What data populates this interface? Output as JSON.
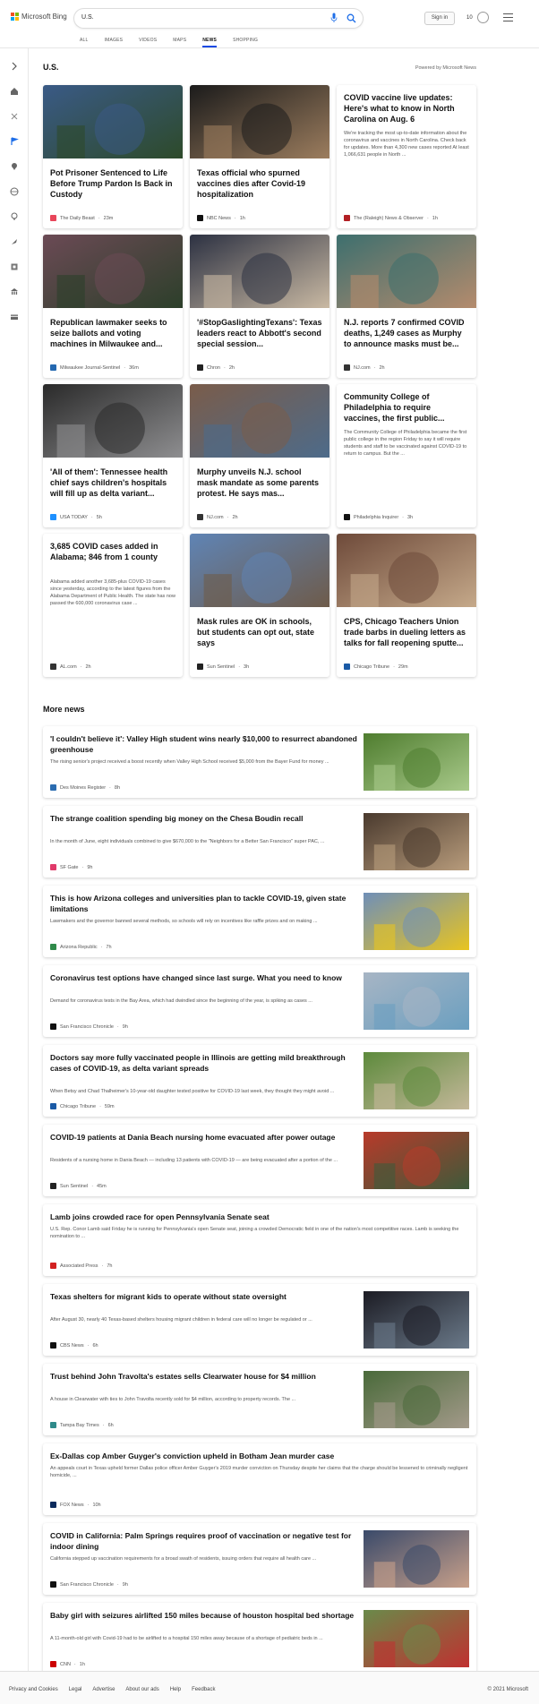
{
  "header": {
    "brand": "Microsoft Bing",
    "search_value": "U.S.",
    "signin_label": "Sign in",
    "rewards_count": "10",
    "tabs": [
      {
        "label": "ALL",
        "active": false
      },
      {
        "label": "IMAGES",
        "active": false
      },
      {
        "label": "VIDEOS",
        "active": false
      },
      {
        "label": "MAPS",
        "active": false
      },
      {
        "label": "NEWS",
        "active": true
      },
      {
        "label": "SHOPPING",
        "active": false
      }
    ]
  },
  "sidebar": {
    "icons": [
      "chevron-right-icon",
      "home-icon",
      "discover-icon",
      "flag-icon",
      "location-icon",
      "globe-icon",
      "lightbulb-icon",
      "rocket-icon",
      "film-icon",
      "bank-icon",
      "card-icon"
    ]
  },
  "section": {
    "title": "U.S.",
    "powered_by": "Powered by Microsoft News"
  },
  "cards": [
    {
      "title": "Pot Prisoner Sentenced to Life Before Trump Pardon Is Back in Custody",
      "body": "",
      "source": "The Daily Beast",
      "time": "23m",
      "has_image": true,
      "image_colors": [
        "#3a5a86",
        "#2d4a2a"
      ],
      "logo_color": "#e8465a"
    },
    {
      "title": "Texas official who spurned vaccines dies after Covid-19 hospitalization",
      "body": "",
      "source": "NBC News",
      "time": "1h",
      "has_image": true,
      "image_colors": [
        "#1b1b1b",
        "#9c7d5e"
      ],
      "logo_color": "#111111"
    },
    {
      "title": "COVID vaccine live updates: Here's what to know in North Carolina on Aug. 6",
      "body": "We're tracking the most up-to-date information about the coronavirus and vaccines in North Carolina. Check back for updates. More than 4,300 new cases reported At least 1,066,631 people in North ...",
      "source": "The (Raleigh) News & Observer",
      "time": "1h",
      "has_image": false,
      "image_colors": [],
      "logo_color": "#b21f24"
    },
    {
      "title": "Republican lawmaker seeks to seize ballots and voting machines in Milwaukee and...",
      "body": "",
      "source": "Milwaukee Journal-Sentinel",
      "time": "36m",
      "has_image": true,
      "image_colors": [
        "#6b4a55",
        "#2c3f2a"
      ],
      "logo_color": "#2468b0"
    },
    {
      "title": "'#StopGaslightingTexans': Texas leaders react to Abbott's second special session...",
      "body": "",
      "source": "Chron",
      "time": "2h",
      "has_image": true,
      "image_colors": [
        "#2c3142",
        "#c9b9a3"
      ],
      "logo_color": "#222222"
    },
    {
      "title": "N.J. reports 7 confirmed COVID deaths, 1,249 cases as Murphy to announce masks must be...",
      "body": "",
      "source": "NJ.com",
      "time": "2h",
      "has_image": true,
      "image_colors": [
        "#3d6f6e",
        "#b48b6d"
      ],
      "logo_color": "#333333"
    },
    {
      "title": "'All of them': Tennessee health chief says children's hospitals will fill up as delta variant...",
      "body": "",
      "source": "USA TODAY",
      "time": "5h",
      "has_image": true,
      "image_colors": [
        "#2a2a2a",
        "#8e8e90"
      ],
      "logo_color": "#1e90ff"
    },
    {
      "title": "Murphy unveils N.J. school mask mandate as some parents protest. He says mas...",
      "body": "",
      "source": "NJ.com",
      "time": "2h",
      "has_image": true,
      "image_colors": [
        "#7a5c4a",
        "#4d6b8a"
      ],
      "logo_color": "#333333"
    },
    {
      "title": "Community College of Philadelphia to require vaccines, the first public...",
      "body": "The Community College of Philadelphia became the first public college in the region Friday to say it will require students and staff to be vaccinated against COVID-19 to return to campus. But the ...",
      "source": "Philadelphia Inquirer",
      "time": "3h",
      "has_image": false,
      "image_colors": [],
      "logo_color": "#111111"
    },
    {
      "title": "3,685 COVID cases added in Alabama; 846 from 1 county",
      "body": "Alabama added another 3,685-plus COVID-19 cases since yesterday, according to the latest figures from the Alabama Department of Public Health. The state has now passed the 600,000 coronavirus case ...",
      "source": "AL.com",
      "time": "2h",
      "has_image": false,
      "image_colors": [],
      "logo_color": "#333333"
    },
    {
      "title": "Mask rules are OK in schools, but students can opt out, state says",
      "body": "",
      "source": "Sun Sentinel",
      "time": "3h",
      "has_image": true,
      "image_colors": [
        "#5f84b5",
        "#6e5b4a"
      ],
      "logo_color": "#222222"
    },
    {
      "title": "CPS, Chicago Teachers Union trade barbs in dueling letters as talks for fall reopening sputte...",
      "body": "",
      "source": "Chicago Tribune",
      "time": "29m",
      "has_image": true,
      "image_colors": [
        "#6e4a3a",
        "#c5a98a"
      ],
      "logo_color": "#1a5aa6"
    }
  ],
  "more_news": {
    "title": "More news",
    "items": [
      {
        "title": "'I couldn't believe it': Valley High student wins nearly $10,000 to resurrect abandoned greenhouse",
        "body": "The rising senior's project received a boost recently when Valley High School received $5,000 from the Bayer Fund for money ...",
        "source": "Des Moines Register",
        "time": "8h",
        "has_image": true,
        "image_colors": [
          "#4f7d2f",
          "#a8c98a"
        ],
        "logo_color": "#2b6cb0"
      },
      {
        "title": "The strange coalition spending big money on the Chesa Boudin recall",
        "body": "In the month of June, eight individuals combined to give $670,000 to the \"Neighbors for a Better San Francisco\" super PAC, ...",
        "source": "SF Gate",
        "time": "9h",
        "has_image": true,
        "image_colors": [
          "#4a3a2e",
          "#b89c7c"
        ],
        "logo_color": "#e03a6a"
      },
      {
        "title": "This is how Arizona colleges and universities plan to tackle COVID-19, given state limitations",
        "body": "Lawmakers and the governor banned several methods, so schools will rely on incentives like raffle prizes and on making ...",
        "source": "Arizona Republic",
        "time": "7h",
        "has_image": true,
        "image_colors": [
          "#6f8fb8",
          "#e8c420"
        ],
        "logo_color": "#2f8a4a"
      },
      {
        "title": "Coronavirus test options have changed since last surge. What you need to know",
        "body": "Demand for coronavirus tests in the Bay Area, which had dwindled since the beginning of the year, is spiking as cases ...",
        "source": "San Francisco Chronicle",
        "time": "9h",
        "has_image": true,
        "image_colors": [
          "#a7b5c4",
          "#6b9fc0"
        ],
        "logo_color": "#111111"
      },
      {
        "title": "Doctors say more fully vaccinated people in Illinois are getting mild breakthrough cases of COVID-19, as delta variant spreads",
        "body": "When Betsy and Chad Thalheimer's 10-year-old daughter tested positive for COVID-19 last week, they thought they might avoid ...",
        "source": "Chicago Tribune",
        "time": "59m",
        "has_image": true,
        "image_colors": [
          "#5d8a3c",
          "#c4b89a"
        ],
        "logo_color": "#1a5aa6"
      },
      {
        "title": "COVID-19 patients at Dania Beach nursing home evacuated after power outage",
        "body": "Residents of a nursing home in Dania Beach — including 13 patients with COVID-19 — are being evacuated after a portion of the ...",
        "source": "Sun Sentinel",
        "time": "45m",
        "has_image": true,
        "image_colors": [
          "#b83a2a",
          "#3e5a3a"
        ],
        "logo_color": "#222222"
      },
      {
        "title": "Lamb joins crowded race for open Pennsylvania Senate seat",
        "body": "U.S. Rep. Conor Lamb said Friday he is running for Pennsylvania's open Senate seat, joining a crowded Democratic field in one of the nation's most competitive races. Lamb is seeking the nomination to ...",
        "source": "Associated Press",
        "time": "7h",
        "has_image": false,
        "image_colors": [],
        "logo_color": "#d22020"
      },
      {
        "title": "Texas shelters for migrant kids to operate without state oversight",
        "body": "After August 30, nearly 40 Texas-based shelters housing migrant children in federal care will no longer be regulated or ...",
        "source": "CBS News",
        "time": "6h",
        "has_image": true,
        "image_colors": [
          "#1c1c24",
          "#6b7a8a"
        ],
        "logo_color": "#111111"
      },
      {
        "title": "Trust behind John Travolta's estates sells Clearwater house for $4 million",
        "body": "A house in Clearwater with ties to John Travolta recently sold for $4 million, according to property records. The ...",
        "source": "Tampa Bay Times",
        "time": "6h",
        "has_image": true,
        "image_colors": [
          "#4a6a3a",
          "#a39a8a"
        ],
        "logo_color": "#2f8a8a"
      },
      {
        "title": "Ex-Dallas cop Amber Guyger's conviction upheld in Botham Jean murder case",
        "body": "An appeals court in Texas upheld former Dallas police officer Amber Guyger's 2019 murder conviction on Thursday despite her claims that the charge should be lessened to criminally negligent homicide, ...",
        "source": "FOX News",
        "time": "10h",
        "has_image": false,
        "image_colors": [],
        "logo_color": "#0b2a5c"
      },
      {
        "title": "COVID in California: Palm Springs requires proof of vaccination or negative test for indoor dining",
        "body": "California stepped up vaccination requirements for a broad swath of residents, issuing orders that require all health care ...",
        "source": "San Francisco Chronicle",
        "time": "9h",
        "has_image": true,
        "image_colors": [
          "#3a4a6a",
          "#c8a08a"
        ],
        "logo_color": "#111111"
      },
      {
        "title": "Baby girl with seizures airlifted 150 miles because of houston hospital bed shortage",
        "body": "A 11-month-old girl with Covid-19 had to be airlifted to a hospital 150 miles away because of a shortage of pediatric beds in ...",
        "source": "CNN",
        "time": "1h",
        "has_image": true,
        "image_colors": [
          "#6a8a4a",
          "#c03030"
        ],
        "logo_color": "#cc0000"
      }
    ]
  },
  "footer": {
    "links": [
      "Privacy and Cookies",
      "Legal",
      "Advertise",
      "About our ads",
      "Help",
      "Feedback"
    ],
    "copyright": "© 2021 Microsoft"
  }
}
